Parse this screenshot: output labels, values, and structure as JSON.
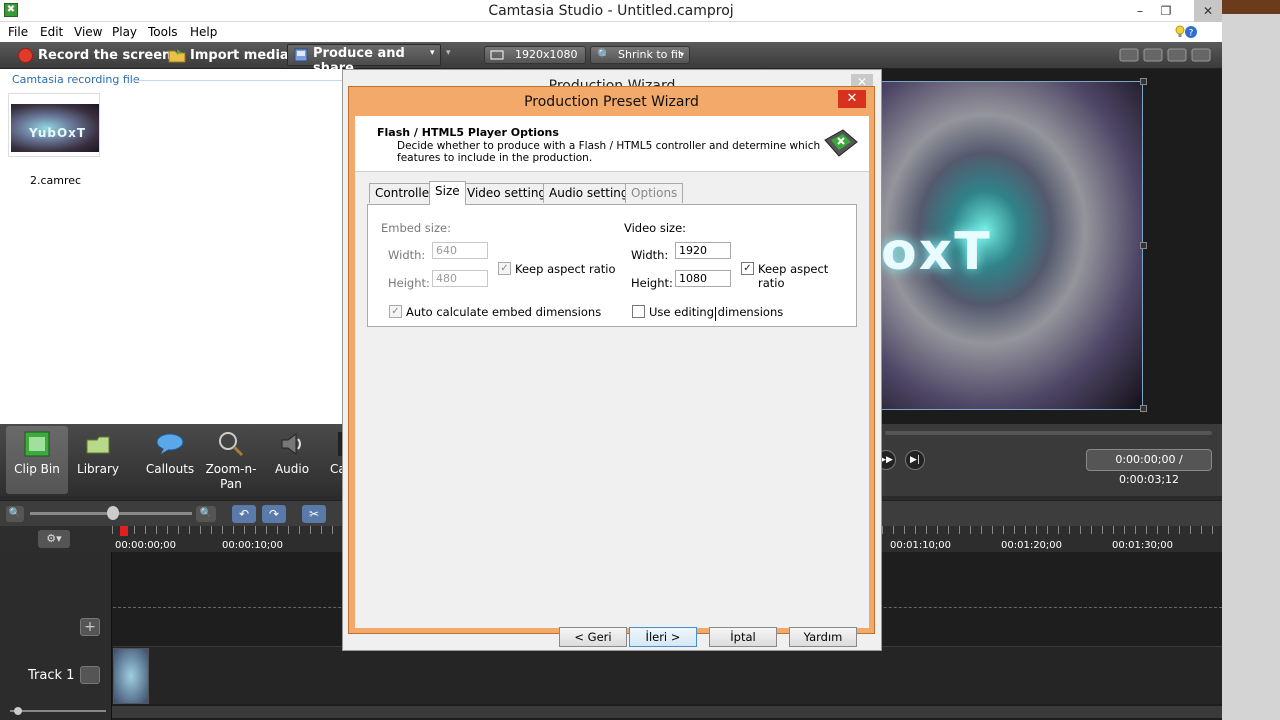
{
  "window": {
    "title": "Camtasia Studio - Untitled.camproj",
    "app_icon_glyph": "✖"
  },
  "menu": [
    "File",
    "Edit",
    "View",
    "Play",
    "Tools",
    "Help"
  ],
  "toolbar": {
    "record": "Record the screen ▾",
    "import": "Import media ▾",
    "produce": "Produce and share",
    "resolution": "1920x1080",
    "zoom": "Shrink to fit"
  },
  "clip_bin": {
    "header": "Camtasia recording file",
    "items": [
      {
        "name": "2.camrec",
        "thumb_text": "YubOxT"
      }
    ]
  },
  "preview": {
    "video_text": "oxT"
  },
  "transport": {
    "timecode": "0:00:00;00 / 0:00:03;12"
  },
  "tools": [
    {
      "id": "clip-bin",
      "label": "Clip Bin"
    },
    {
      "id": "library",
      "label": "Library"
    },
    {
      "id": "callouts",
      "label": "Callouts"
    },
    {
      "id": "zoom-n-pan",
      "label": "Zoom-n-\nPan"
    },
    {
      "id": "audio",
      "label": "Audio"
    },
    {
      "id": "more",
      "label": "Ca"
    }
  ],
  "timeline": {
    "ruler_labels_left": [
      "00:00:00;00",
      "00:00:10;00"
    ],
    "ruler_labels_right": [
      "00:01:10;00",
      "00:01:20;00",
      "00:01:30;00"
    ],
    "track_name": "Track 1"
  },
  "wizard_back": {
    "title": "Production Wizard"
  },
  "wizard": {
    "title": "Production Preset Wizard",
    "header_title": "Flash / HTML5 Player Options",
    "header_desc": "Decide whether to produce with a Flash / HTML5 controller and determine which features to include in the production.",
    "tabs": [
      "Controller",
      "Size",
      "Video settings",
      "Audio settings",
      "Options"
    ],
    "embed": {
      "label": "Embed size:",
      "width_label": "Width:",
      "height_label": "Height:",
      "width": "640",
      "height": "480",
      "keep_aspect": "Keep aspect ratio",
      "auto_calc": "Auto calculate embed dimensions"
    },
    "video": {
      "label": "Video size:",
      "width_label": "Width:",
      "height_label": "Height:",
      "width": "1920",
      "height": "1080",
      "keep_aspect": "Keep aspect ratio",
      "use_editing": "Use editing dimensions"
    },
    "buttons": {
      "back": "< Geri",
      "next": "İleri >",
      "cancel": "İptal",
      "help": "Yardım"
    }
  },
  "colors": {
    "wizard_frame": "#f2a96a",
    "close_red": "#d7321e",
    "accent_blue": "#2a6db0"
  }
}
